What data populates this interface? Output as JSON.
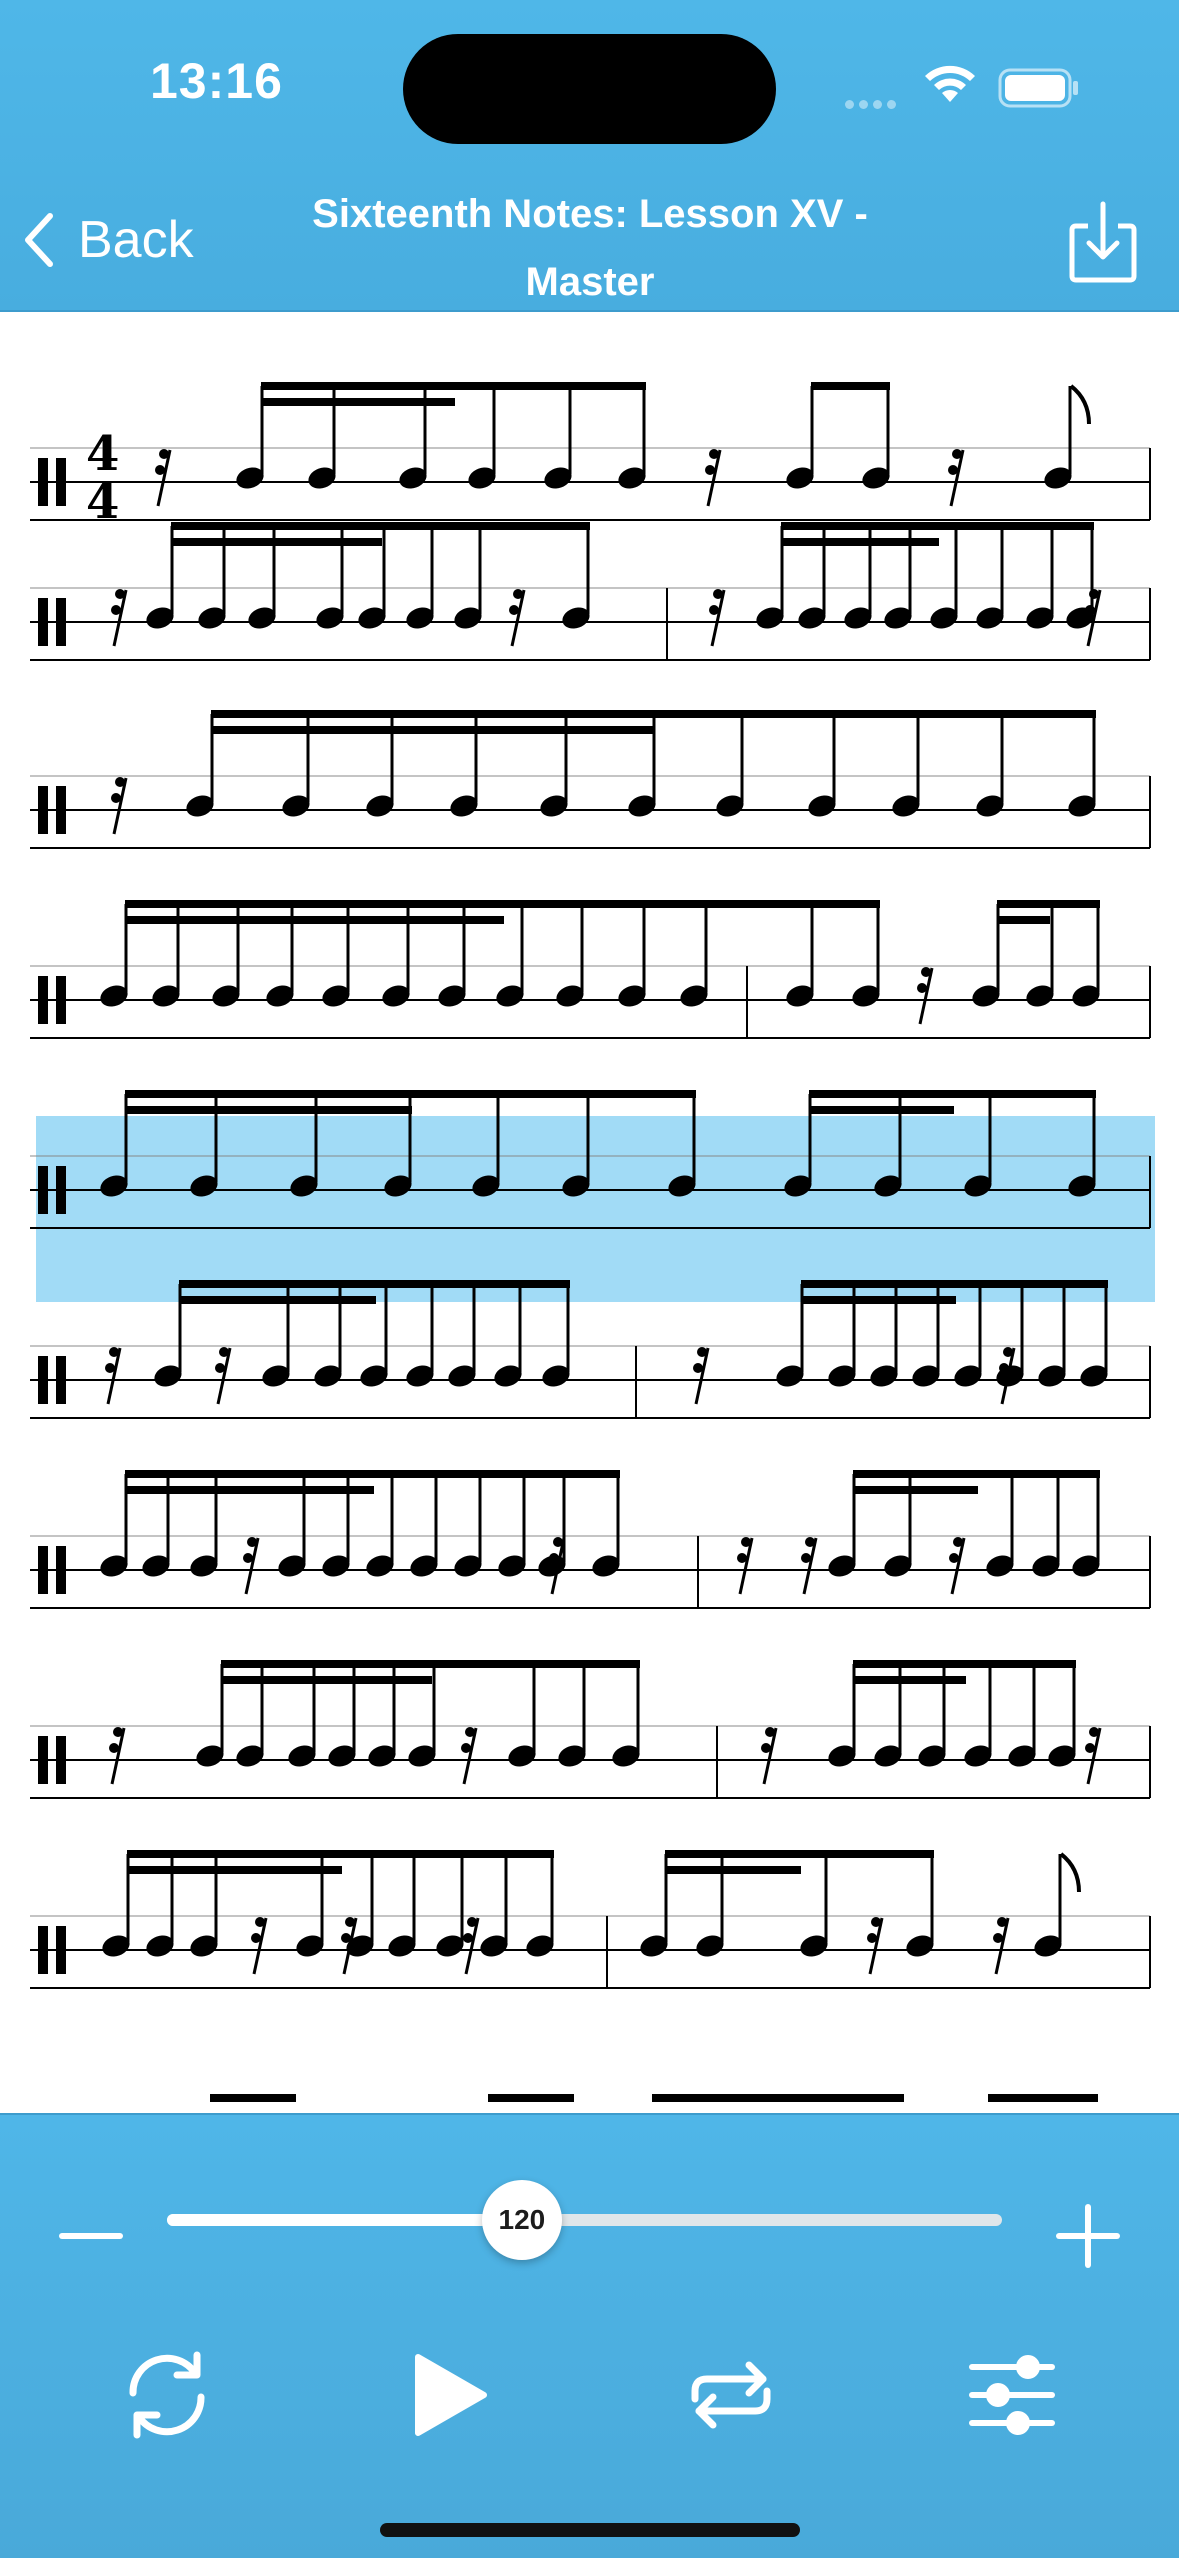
{
  "status_bar": {
    "time": "13:16"
  },
  "nav": {
    "back_label": "Back",
    "title_line1": "Sixteenth Notes: Lesson XV -",
    "title_line2": "Master",
    "download_icon": "download-tray-icon"
  },
  "score": {
    "time_signature": {
      "numerator": "4",
      "denominator": "4"
    },
    "highlighted_line": 5,
    "line_count_visible": 9
  },
  "playback": {
    "tempo": "120",
    "tempo_fraction": 0.425,
    "controls": [
      "sync-icon",
      "play-icon",
      "loop-icon",
      "sliders-icon"
    ]
  },
  "colors": {
    "accent": "#4fb7e8",
    "highlight": "#54beee",
    "ink": "#000000"
  }
}
